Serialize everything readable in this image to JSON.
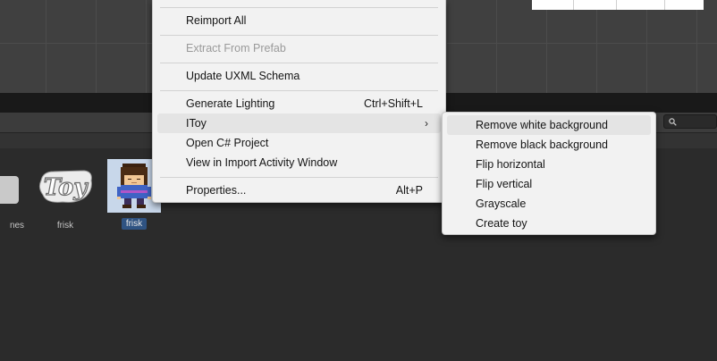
{
  "context_menu": {
    "items": [
      {
        "label": "Reimport All",
        "shortcut": "",
        "disabled": false
      },
      {
        "label": "Extract From Prefab",
        "shortcut": "",
        "disabled": true
      },
      {
        "label": "Update UXML Schema",
        "shortcut": ""
      },
      {
        "label": "Generate Lighting",
        "shortcut": "Ctrl+Shift+L"
      },
      {
        "label": "IToy",
        "shortcut": "",
        "has_submenu": true,
        "highlighted": true
      },
      {
        "label": "Open C# Project",
        "shortcut": ""
      },
      {
        "label": "View in Import Activity Window",
        "shortcut": ""
      },
      {
        "label": "Properties...",
        "shortcut": "Alt+P"
      }
    ]
  },
  "submenu": {
    "items": [
      {
        "label": "Remove white background",
        "highlighted": true
      },
      {
        "label": "Remove black background"
      },
      {
        "label": "Flip horizontal"
      },
      {
        "label": "Flip vertical"
      },
      {
        "label": "Grayscale"
      },
      {
        "label": "Create toy"
      }
    ]
  },
  "assets": [
    {
      "label": "nes",
      "icon": "asset-folder-icon"
    },
    {
      "label": "frisk",
      "icon": "toy-logo-icon"
    },
    {
      "label": "frisk",
      "icon": "frisk-sprite-icon",
      "selected": true
    }
  ],
  "colors": {
    "menu_bg": "#f2f2f2",
    "menu_highlight": "#e4e4e4",
    "selection_blue": "#2f5382",
    "editor_bg": "#2b2b2b"
  }
}
